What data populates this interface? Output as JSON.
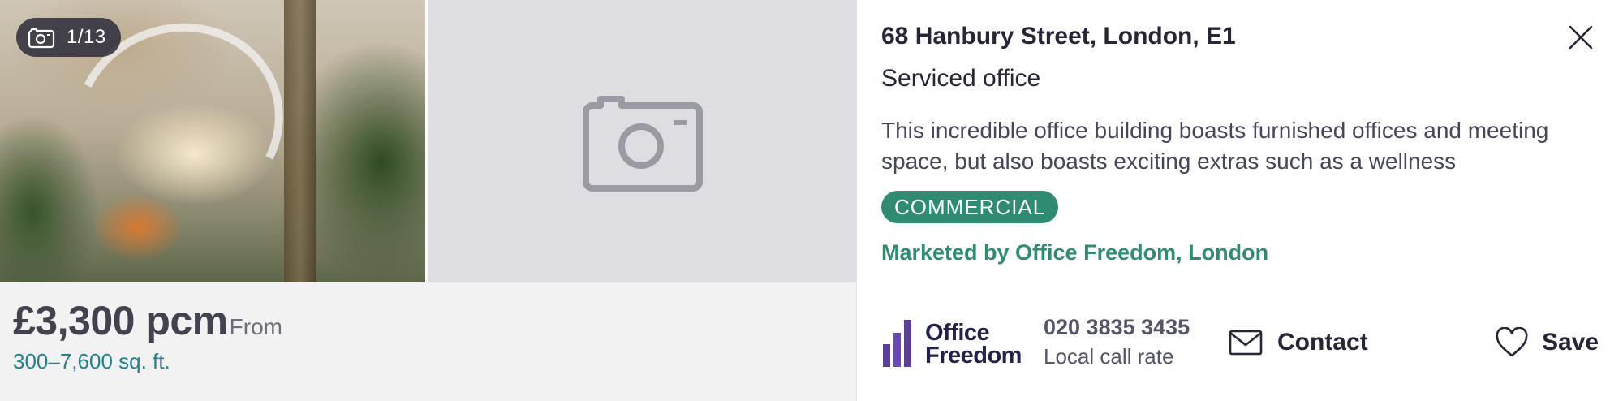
{
  "listing": {
    "photo_counter": "1/13",
    "price": "£3,300 pcm",
    "price_qualifier": "From",
    "size": "300–7,600 sq. ft.",
    "address": "68 Hanbury Street, London, E1",
    "property_type": "Serviced office",
    "summary": "This incredible office building boasts furnished offices and meeting space, but also boasts exciting extras such as a wellness",
    "tag": "COMMERCIAL",
    "marketed_by": "Marketed by Office Freedom, London"
  },
  "agent": {
    "logo_line1": "Office",
    "logo_line2": "Freedom",
    "phone": "020 3835 3435",
    "call_note": "Local call rate"
  },
  "actions": {
    "contact_label": "Contact",
    "save_label": "Save"
  },
  "icons": {
    "photo_counter": "camera-icon",
    "placeholder": "camera-placeholder-icon",
    "close": "close-icon",
    "contact": "envelope-icon",
    "save": "heart-icon"
  },
  "colors": {
    "brand_green": "#2f8b71",
    "size_teal": "#25818a",
    "text_dark": "#262637",
    "placeholder_bg": "#dedee2",
    "price_bg": "#f2f2f3",
    "logo_purple": "#5b3f9a"
  }
}
